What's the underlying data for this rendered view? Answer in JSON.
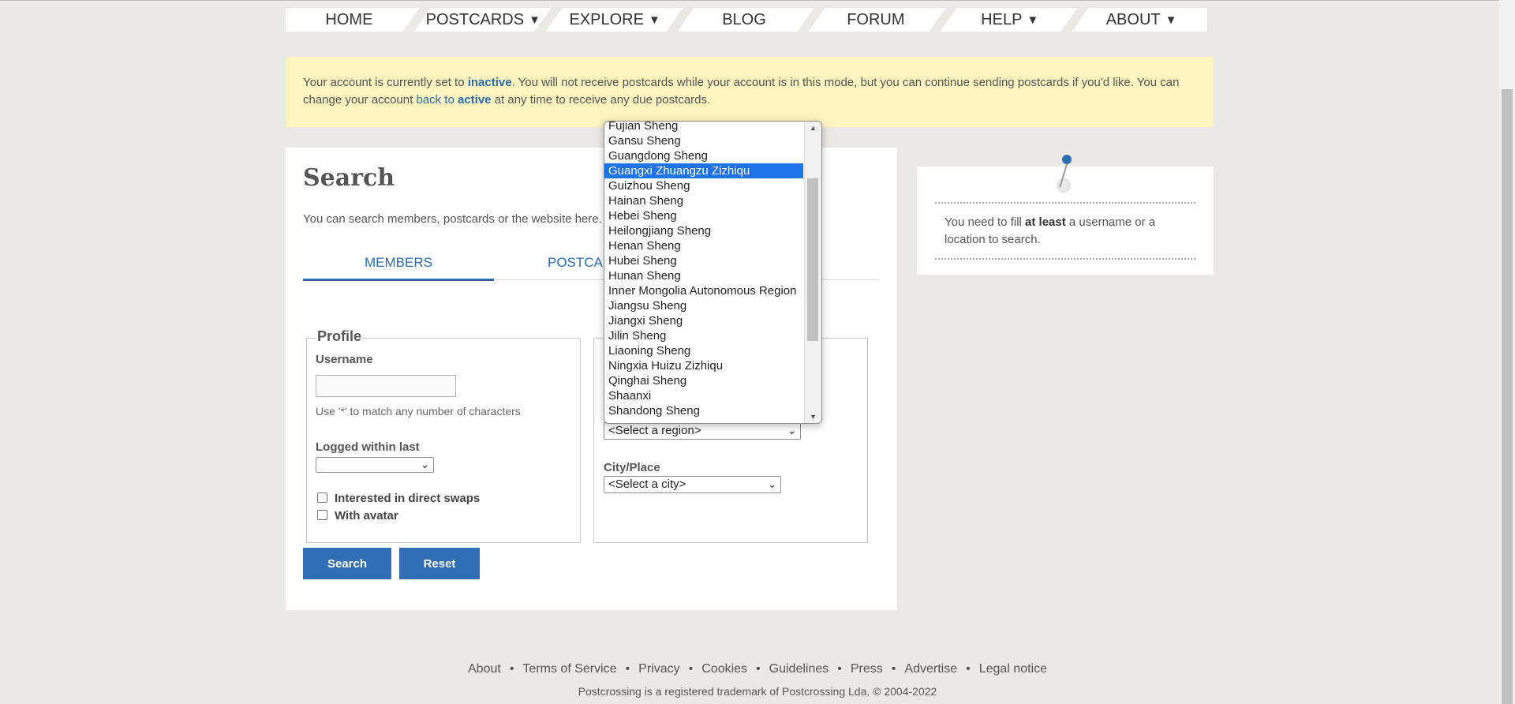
{
  "nav": [
    {
      "label": "HOME",
      "caret": ""
    },
    {
      "label": "POSTCARDS",
      "caret": "▼"
    },
    {
      "label": "EXPLORE",
      "caret": "▼"
    },
    {
      "label": "BLOG",
      "caret": ""
    },
    {
      "label": "FORUM",
      "caret": ""
    },
    {
      "label": "HELP",
      "caret": "▼"
    },
    {
      "label": "ABOUT",
      "caret": "▼"
    }
  ],
  "notice": {
    "p1": "Your account is currently set to ",
    "inactive": "inactive",
    "p2": ". You will not receive postcards while your account is in this mode, but you can continue sending postcards if you'd like. You can change your account ",
    "back_to": "back to ",
    "active": "active",
    "p3": " at any time to receive any due postcards."
  },
  "search": {
    "title": "Search",
    "intro": "You can search members, postcards or the website here.",
    "tabs": {
      "members": "MEMBERS",
      "postcards": "POSTCA"
    }
  },
  "profile": {
    "legend": "Profile",
    "username_label": "Username",
    "username_value": "",
    "username_hint": "Use '*' to match any number of characters",
    "logged_label": "Logged within last",
    "logged_value": "",
    "swaps_label": "Interested in direct swaps",
    "avatar_label": "With avatar"
  },
  "location": {
    "region_value": "<Select a region>",
    "city_label": "City/Place",
    "city_value": "<Select a city>"
  },
  "buttons": {
    "search": "Search",
    "reset": "Reset"
  },
  "side": {
    "p1": "You need to fill ",
    "bold": "at least",
    "p2": " a username or a location to search."
  },
  "region_options": [
    "Fujian Sheng",
    "Gansu Sheng",
    "Guangdong Sheng",
    "Guangxi Zhuangzu Zizhiqu",
    "Guizhou Sheng",
    "Hainan Sheng",
    "Hebei Sheng",
    "Heilongjiang Sheng",
    "Henan Sheng",
    "Hubei Sheng",
    "Hunan Sheng",
    "Inner Mongolia Autonomous Region",
    "Jiangsu Sheng",
    "Jiangxi Sheng",
    "Jilin Sheng",
    "Liaoning Sheng",
    "Ningxia Huizu Zizhiqu",
    "Qinghai Sheng",
    "Shaanxi",
    "Shandong Sheng"
  ],
  "selected_region": "Guangxi Zhuangzu Zizhiqu",
  "footer": {
    "links": [
      "About",
      "Terms of Service",
      "Privacy",
      "Cookies",
      "Guidelines",
      "Press",
      "Advertise",
      "Legal notice"
    ],
    "separator": "•",
    "copyright": "Postcrossing is a registered trademark of Postcrossing Lda. © 2004-2022"
  },
  "colors": {
    "accent": "#2f6db4",
    "notice_bg": "#fcf3bf",
    "selected_option": "#1f73e8"
  }
}
